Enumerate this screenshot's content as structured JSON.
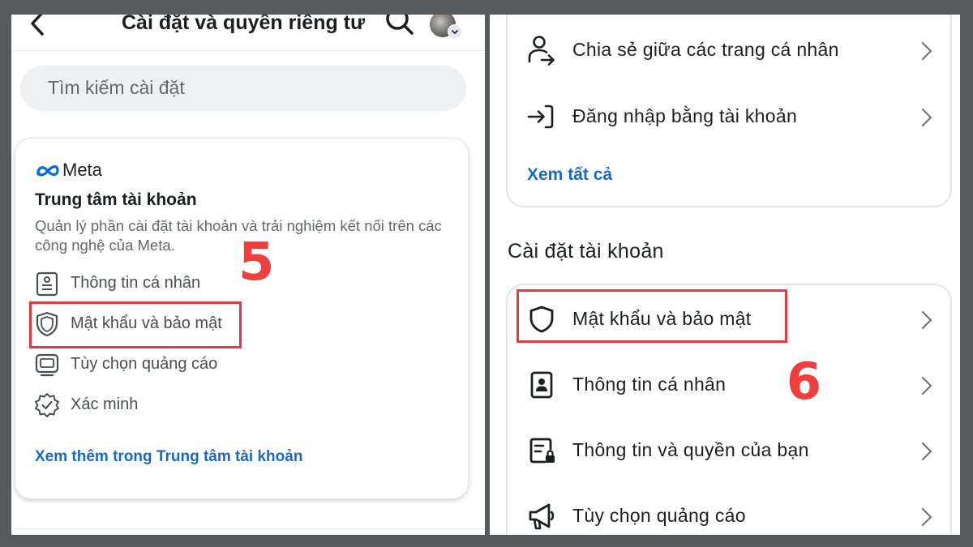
{
  "left_panel": {
    "header": {
      "title": "Cài đặt và quyền riêng tư"
    },
    "search": {
      "placeholder": "Tìm kiếm cài đặt"
    },
    "accounts_center": {
      "brand": "Meta",
      "title": "Trung tâm tài khoản",
      "description": "Quản lý phần cài đặt tài khoản và trải nghiệm kết nối trên các công nghệ của Meta.",
      "items": [
        {
          "label": "Thông tin cá nhân",
          "icon": "id-card-icon"
        },
        {
          "label": "Mật khẩu và bảo mật",
          "icon": "shield-icon"
        },
        {
          "label": "Tùy chọn quảng cáo",
          "icon": "monitor-icon"
        },
        {
          "label": "Xác minh",
          "icon": "verified-badge-icon"
        }
      ],
      "see_more": "Xem thêm trong Trung tâm tài khoản"
    },
    "step_label": "5"
  },
  "right_panel": {
    "top_card": {
      "items": [
        {
          "label": "Chia sẻ giữa các trang cá nhân",
          "icon": "person-share-icon"
        },
        {
          "label": "Đăng nhập bằng tài khoản",
          "icon": "login-arrow-icon"
        }
      ],
      "see_all": "Xem tất cả"
    },
    "section_title": "Cài đặt tài khoản",
    "account_settings": {
      "items": [
        {
          "label": "Mật khẩu và bảo mật",
          "icon": "shield-icon"
        },
        {
          "label": "Thông tin cá nhân",
          "icon": "id-badge-icon"
        },
        {
          "label": "Thông tin và quyền của bạn",
          "icon": "document-lock-icon"
        },
        {
          "label": "Tùy chọn quảng cáo",
          "icon": "megaphone-icon"
        }
      ]
    },
    "step_label": "6"
  },
  "colors": {
    "background": "#58595b",
    "highlight": "#e5393d",
    "step_number": "#ee3e3e",
    "link": "#1b69c7",
    "meta_blue": "#0668e1"
  }
}
